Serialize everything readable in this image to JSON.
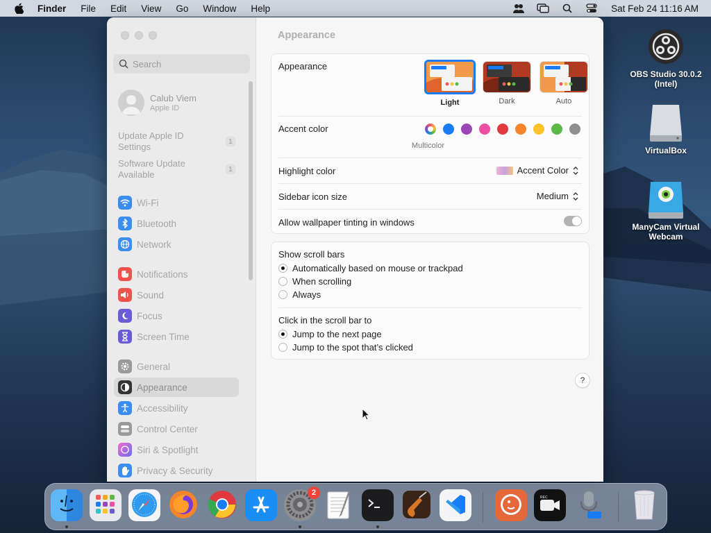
{
  "menubar": {
    "app_name": "Finder",
    "items": [
      "File",
      "Edit",
      "View",
      "Go",
      "Window",
      "Help"
    ],
    "clock": "Sat Feb 24  11:16 AM"
  },
  "sidebar": {
    "search_placeholder": "Search",
    "profile": {
      "name": "Calub Viem",
      "subtitle": "Apple ID"
    },
    "notices": [
      {
        "label": "Update Apple ID Settings",
        "badge": "1"
      },
      {
        "label": "Software Update Available",
        "badge": "1"
      }
    ],
    "items": [
      {
        "label": "Wi-Fi",
        "icon": "wifi-icon",
        "color": "#3b8ef0"
      },
      {
        "label": "Bluetooth",
        "icon": "bluetooth-icon",
        "color": "#3b8ef0"
      },
      {
        "label": "Network",
        "icon": "network-icon",
        "color": "#3b8ef0"
      },
      {
        "label": "Notifications",
        "icon": "notifications-icon",
        "color": "#f0534b"
      },
      {
        "label": "Sound",
        "icon": "sound-icon",
        "color": "#f0534b"
      },
      {
        "label": "Focus",
        "icon": "focus-icon",
        "color": "#6a5cd6"
      },
      {
        "label": "Screen Time",
        "icon": "screen-time-icon",
        "color": "#6a5cd6"
      },
      {
        "label": "General",
        "icon": "gear-icon",
        "color": "#9a9a9a"
      },
      {
        "label": "Appearance",
        "icon": "appearance-icon",
        "color": "#333333",
        "selected": true
      },
      {
        "label": "Accessibility",
        "icon": "accessibility-icon",
        "color": "#3b8ef0"
      },
      {
        "label": "Control Center",
        "icon": "control-center-icon",
        "color": "#9a9a9a"
      },
      {
        "label": "Siri & Spotlight",
        "icon": "siri-icon",
        "color": "#c85ad6"
      },
      {
        "label": "Privacy & Security",
        "icon": "hand-icon",
        "color": "#3b8ef0"
      }
    ]
  },
  "main": {
    "title": "Appearance",
    "appearance": {
      "label": "Appearance",
      "options": [
        {
          "label": "Light",
          "selected": true
        },
        {
          "label": "Dark",
          "selected": false
        },
        {
          "label": "Auto",
          "selected": false
        }
      ]
    },
    "accent": {
      "label": "Accent color",
      "colors": [
        "multicolor",
        "#1a7cf5",
        "#9b47b8",
        "#ec4fa2",
        "#e0393e",
        "#f5842a",
        "#fcc42a",
        "#5bb947",
        "#8e8e8e"
      ],
      "selected_label": "Multicolor"
    },
    "highlight": {
      "label": "Highlight color",
      "value": "Accent Color"
    },
    "sidebar_icon_size": {
      "label": "Sidebar icon size",
      "value": "Medium"
    },
    "wallpaper_tinting": {
      "label": "Allow wallpaper tinting in windows",
      "on": false
    },
    "scroll_bars": {
      "label": "Show scroll bars",
      "options": [
        {
          "label": "Automatically based on mouse or trackpad",
          "checked": true
        },
        {
          "label": "When scrolling",
          "checked": false
        },
        {
          "label": "Always",
          "checked": false
        }
      ]
    },
    "click_scroll": {
      "label": "Click in the scroll bar to",
      "options": [
        {
          "label": "Jump to the next page",
          "checked": true
        },
        {
          "label": "Jump to the spot that’s clicked",
          "checked": false
        }
      ]
    },
    "help": "?"
  },
  "desktop": {
    "icons": [
      {
        "label": "OBS Studio 30.0.2 (Intel)",
        "icon": "obs-icon"
      },
      {
        "label": "VirtualBox",
        "icon": "disk-icon"
      },
      {
        "label": "ManyCam Virtual Webcam",
        "icon": "manycam-icon"
      }
    ]
  },
  "dock": {
    "apps": [
      {
        "name": "Finder",
        "icon": "finder-icon",
        "running": true
      },
      {
        "name": "Launchpad",
        "icon": "launchpad-icon",
        "running": false
      },
      {
        "name": "Safari",
        "icon": "safari-icon",
        "running": false
      },
      {
        "name": "Firefox",
        "icon": "firefox-icon",
        "running": false
      },
      {
        "name": "Chrome",
        "icon": "chrome-icon",
        "running": false
      },
      {
        "name": "App Store",
        "icon": "app-store-icon",
        "running": false
      },
      {
        "name": "System Settings",
        "icon": "system-settings-icon",
        "running": true,
        "badge": "2"
      },
      {
        "name": "TextEdit",
        "icon": "textedit-icon",
        "running": false
      },
      {
        "name": "Terminal",
        "icon": "terminal-icon",
        "running": true
      },
      {
        "name": "GarageBand",
        "icon": "garageband-icon",
        "running": false
      },
      {
        "name": "VS Code",
        "icon": "vscode-icon",
        "running": false
      },
      {
        "name": "DuckDuckGo",
        "icon": "duckduckgo-icon",
        "running": false
      },
      {
        "name": "Screen Recorder",
        "icon": "recorder-icon",
        "running": false
      },
      {
        "name": "Audio Recorder",
        "icon": "microphone-icon",
        "running": false
      },
      {
        "name": "Trash",
        "icon": "trash-icon",
        "running": false
      }
    ]
  }
}
